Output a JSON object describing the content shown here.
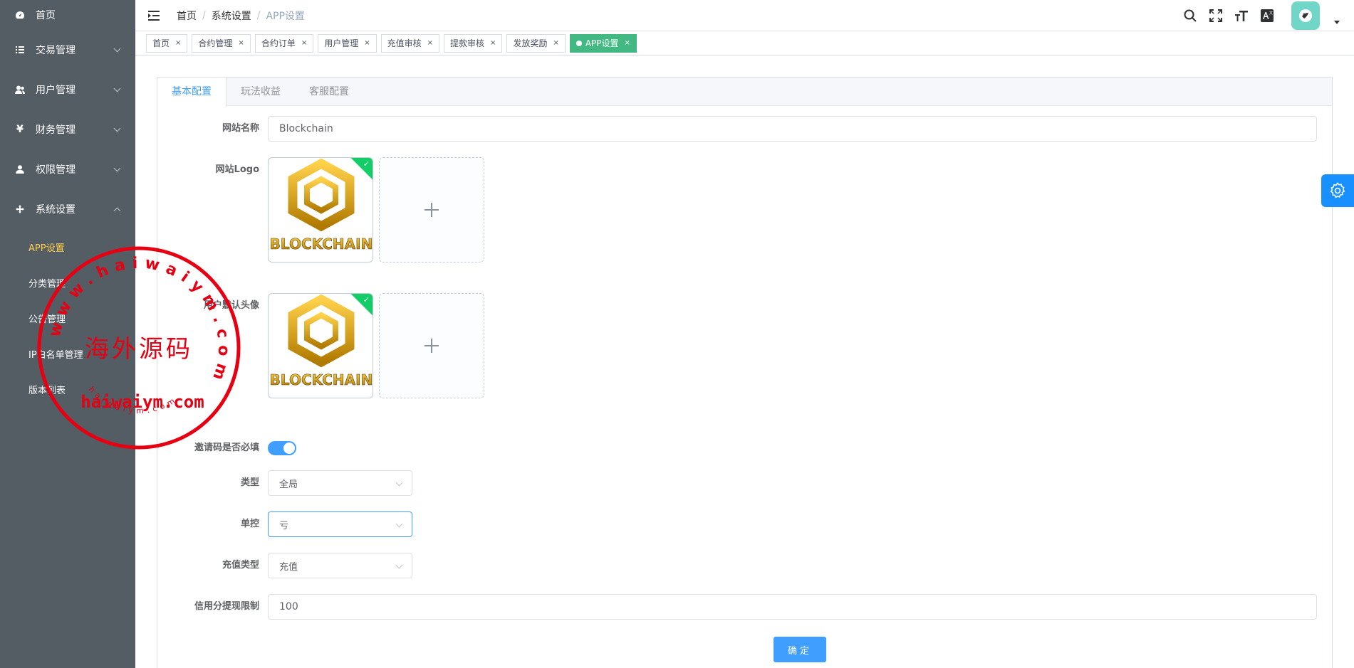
{
  "sidebar": {
    "items": [
      {
        "label": "首页",
        "icon": "dashboard-icon"
      },
      {
        "label": "交易管理",
        "icon": "list-icon"
      },
      {
        "label": "用户管理",
        "icon": "users-icon"
      },
      {
        "label": "财务管理",
        "icon": "yen-icon"
      },
      {
        "label": "权限管理",
        "icon": "user-icon"
      },
      {
        "label": "系统设置",
        "icon": "move-icon"
      }
    ],
    "sub_items": [
      {
        "label": "APP设置"
      },
      {
        "label": "分类管理"
      },
      {
        "label": "公告管理"
      },
      {
        "label": "IP白名单管理"
      },
      {
        "label": "版本列表"
      }
    ]
  },
  "navbar": {
    "breadcrumb": [
      "首页",
      "系统设置",
      "APP设置"
    ],
    "breadcrumb_sep": "/"
  },
  "tags": [
    {
      "label": "首页"
    },
    {
      "label": "合约管理"
    },
    {
      "label": "合约订单"
    },
    {
      "label": "用户管理"
    },
    {
      "label": "充值审核"
    },
    {
      "label": "提款审核"
    },
    {
      "label": "发放奖励"
    },
    {
      "label": "APP设置"
    }
  ],
  "tags_close": "×",
  "tabs": [
    {
      "label": "基本配置"
    },
    {
      "label": "玩法收益"
    },
    {
      "label": "客服配置"
    }
  ],
  "form": {
    "site_name": {
      "label": "网站名称",
      "value": "Blockchain"
    },
    "site_logo": {
      "label": "网站Logo",
      "image_text": "BLOCKCHAIN"
    },
    "default_avatar": {
      "label": "用户默认头像",
      "image_text": "BLOCKCHAIN"
    },
    "invite_required": {
      "label": "邀请码是否必填"
    },
    "type": {
      "label": "类型",
      "value": "全局"
    },
    "single_control": {
      "label": "单控",
      "value": "亏"
    },
    "recharge_type": {
      "label": "充值类型",
      "value": "充值"
    },
    "credit_limit": {
      "label": "信用分提现限制",
      "value": "100"
    },
    "submit_label": "确定"
  },
  "watermark": {
    "center_text": "海外源码",
    "bottom_text": "haiwaiym.com",
    "ring_text": "www.haiwaiym.com",
    "small_ring_text": "haiwaiym.com"
  },
  "colors": {
    "sidebar_bg": "#545c64",
    "active_submenu": "#ffd04b",
    "primary": "#409eff",
    "tag_active": "#42b983",
    "upload_badge": "#13ce66",
    "watermark": "#e60012"
  }
}
